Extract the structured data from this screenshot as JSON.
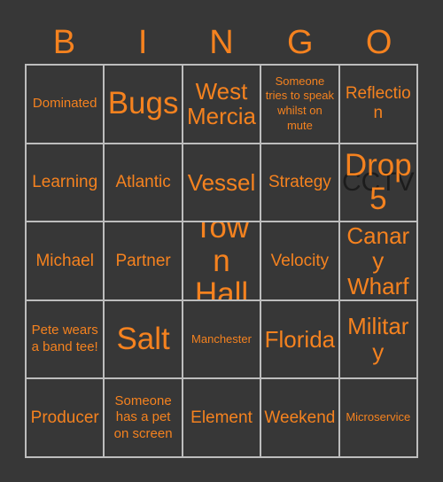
{
  "colors": {
    "background": "#373737",
    "text_accent": "#F5821F",
    "grid_line": "#BDBDBD",
    "stamp": "#1C1C1C"
  },
  "header": {
    "letters": [
      "B",
      "I",
      "N",
      "G",
      "O"
    ]
  },
  "grid": {
    "rows": [
      [
        {
          "text": "Dominated",
          "size": "sz-sm"
        },
        {
          "text": "Bugs",
          "size": "sz-xl"
        },
        {
          "text": "West Mercia",
          "size": "sz-lg"
        },
        {
          "text": "Someone tries to speak whilst on mute",
          "size": "sz-xs"
        },
        {
          "text": "Reflection",
          "size": "sz-md"
        }
      ],
      [
        {
          "text": "Learning",
          "size": "sz-md"
        },
        {
          "text": "Atlantic",
          "size": "sz-md"
        },
        {
          "text": "Vessel",
          "size": "sz-lg"
        },
        {
          "text": "Strategy",
          "size": "sz-md"
        },
        {
          "text": "Drop 5",
          "size": "sz-xl",
          "stamp": "CCTV"
        }
      ],
      [
        {
          "text": "Michael",
          "size": "sz-md"
        },
        {
          "text": "Partner",
          "size": "sz-md"
        },
        {
          "text": "Town Hall",
          "size": "sz-xl"
        },
        {
          "text": "Velocity",
          "size": "sz-md"
        },
        {
          "text": "Canary Wharf",
          "size": "sz-lg"
        }
      ],
      [
        {
          "text": "Pete wears a band tee!",
          "size": "sz-sm"
        },
        {
          "text": "Salt",
          "size": "sz-xl"
        },
        {
          "text": "Manchester",
          "size": "sz-xs"
        },
        {
          "text": "Florida",
          "size": "sz-lg"
        },
        {
          "text": "Military",
          "size": "sz-lg"
        }
      ],
      [
        {
          "text": "Producer",
          "size": "sz-md"
        },
        {
          "text": "Someone has a pet on screen",
          "size": "sz-sm"
        },
        {
          "text": "Element",
          "size": "sz-md"
        },
        {
          "text": "Weekend",
          "size": "sz-md"
        },
        {
          "text": "Microservice",
          "size": "sz-xs"
        }
      ]
    ]
  }
}
